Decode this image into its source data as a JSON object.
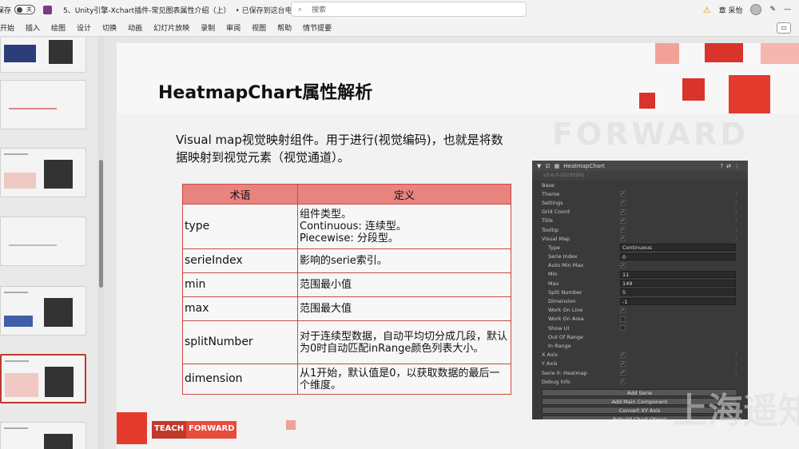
{
  "titlebar": {
    "autosave_label": "自动保存",
    "autosave_state": "关",
    "doc_title": "5、Unity引擎-Xchart插件-常见图表属性介绍（上）",
    "saved_status": "• 已保存到这台电脑 ⌄",
    "search_placeholder": "搜索",
    "user_name": "章 采怡"
  },
  "ribbon": {
    "tabs": [
      "开始",
      "插入",
      "绘图",
      "设计",
      "切换",
      "动画",
      "幻灯片放映",
      "录制",
      "审阅",
      "视图",
      "帮助",
      "情节提要"
    ]
  },
  "slide": {
    "title": "HeatmapChart属性解析",
    "watermark": "FORWARD",
    "paragraph": "Visual map视觉映射组件。用于进行(视觉编码)，也就是将数据映射到视觉元素（视觉通道）。",
    "table": {
      "headers": [
        "术语",
        "定义"
      ],
      "rows": [
        {
          "term": "type",
          "definition": "组件类型。\nContinuous: 连续型。\nPiecewise: 分段型。"
        },
        {
          "term": "serieIndex",
          "definition": "影响的serie索引。"
        },
        {
          "term": "min",
          "definition": "范围最小值"
        },
        {
          "term": "max",
          "definition": "范围最大值"
        },
        {
          "term": "splitNumber",
          "definition": "对于连续型数据，自动平均切分成几段，默认为0时自动匹配inRange颜色列表大小。"
        },
        {
          "term": "dimension",
          "definition": "从1开始，默认值是0，以获取数据的最后一个维度。"
        }
      ]
    },
    "logo": {
      "part1": "TEACH",
      "part2": "FORWARD"
    }
  },
  "inspector": {
    "component": "HeatmapChart",
    "version": "v3.6.0-20230201",
    "rows": [
      {
        "label": "Base",
        "indent": 0,
        "kind": "fold"
      },
      {
        "label": "Theme",
        "indent": 0,
        "kind": "check",
        "dots": true
      },
      {
        "label": "Settings",
        "indent": 0,
        "kind": "check",
        "dots": true
      },
      {
        "label": "Grid Coord",
        "indent": 0,
        "kind": "check",
        "dots": true
      },
      {
        "label": "Title",
        "indent": 0,
        "kind": "check",
        "dots": true
      },
      {
        "label": "Tooltip",
        "indent": 0,
        "kind": "check",
        "dots": true
      },
      {
        "label": "Visual Map",
        "indent": 0,
        "kind": "check",
        "dots": true
      },
      {
        "label": "Type",
        "indent": 1,
        "kind": "value",
        "value": "Continuous"
      },
      {
        "label": "Serie Index",
        "indent": 1,
        "kind": "value",
        "value": "0"
      },
      {
        "label": "Auto Min Max",
        "indent": 1,
        "kind": "check"
      },
      {
        "label": "Min",
        "indent": 1,
        "kind": "value",
        "value": "11"
      },
      {
        "label": "Max",
        "indent": 1,
        "kind": "value",
        "value": "149"
      },
      {
        "label": "Split Number",
        "indent": 1,
        "kind": "value",
        "value": "5"
      },
      {
        "label": "Dimension",
        "indent": 1,
        "kind": "value",
        "value": "-1"
      },
      {
        "label": "Work On Line",
        "indent": 1,
        "kind": "check"
      },
      {
        "label": "Work On Area",
        "indent": 1,
        "kind": "box"
      },
      {
        "label": "Show UI",
        "indent": 1,
        "kind": "box"
      },
      {
        "label": "Out Of Range",
        "indent": 1,
        "kind": "fold"
      },
      {
        "label": "In Range",
        "indent": 1,
        "kind": "fold"
      },
      {
        "label": "X Axis",
        "indent": 0,
        "kind": "check",
        "dots": true
      },
      {
        "label": "Y Axis",
        "indent": 0,
        "kind": "check",
        "dots": true
      },
      {
        "label": "Serie 0: Heatmap",
        "indent": 0,
        "kind": "check",
        "dots": true
      },
      {
        "label": "Debug Info",
        "indent": 0,
        "kind": "check"
      }
    ],
    "buttons": [
      "Add Serie",
      "Add Main Component",
      "Convert XY Axis",
      "Rebuild Chart Object"
    ],
    "overlay_text": "上海遥知"
  }
}
